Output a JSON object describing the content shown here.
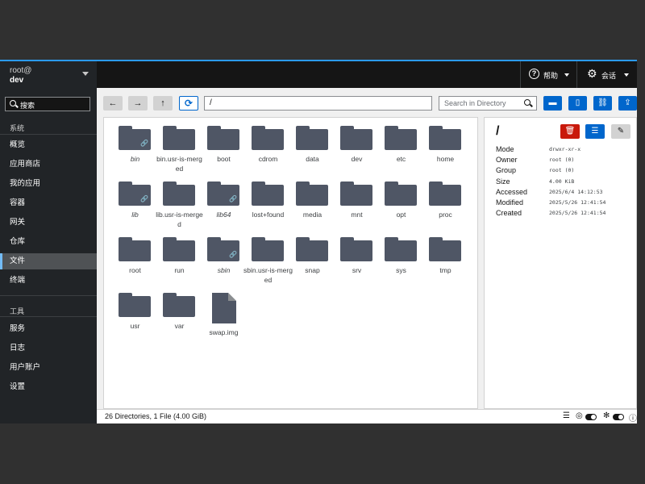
{
  "sidebar": {
    "host_user": "root@",
    "host_name": "dev",
    "search_placeholder": "搜索",
    "section_system": "系统",
    "system_items": [
      "概览",
      "应用商店",
      "我的应用",
      "容器",
      "网关",
      "仓库",
      "文件",
      "终端"
    ],
    "active_item": "文件",
    "section_tools": "工具",
    "tools_items": [
      "服务",
      "日志",
      "用户账户",
      "设置"
    ]
  },
  "topbar": {
    "help_label": "帮助",
    "session_label": "会话"
  },
  "toolbar": {
    "path": "/",
    "search_placeholder": "Search in Directory"
  },
  "files": [
    {
      "name": "bin",
      "type": "folder",
      "link": true
    },
    {
      "name": "bin.usr-is-merged",
      "type": "folder",
      "link": false
    },
    {
      "name": "boot",
      "type": "folder",
      "link": false
    },
    {
      "name": "cdrom",
      "type": "folder",
      "link": false
    },
    {
      "name": "data",
      "type": "folder",
      "link": false
    },
    {
      "name": "dev",
      "type": "folder",
      "link": false
    },
    {
      "name": "etc",
      "type": "folder",
      "link": false
    },
    {
      "name": "home",
      "type": "folder",
      "link": false
    },
    {
      "name": "lib",
      "type": "folder",
      "link": true
    },
    {
      "name": "lib.usr-is-merged",
      "type": "folder",
      "link": false
    },
    {
      "name": "lib64",
      "type": "folder",
      "link": true
    },
    {
      "name": "lost+found",
      "type": "folder",
      "link": false
    },
    {
      "name": "media",
      "type": "folder",
      "link": false
    },
    {
      "name": "mnt",
      "type": "folder",
      "link": false
    },
    {
      "name": "opt",
      "type": "folder",
      "link": false
    },
    {
      "name": "proc",
      "type": "folder",
      "link": false
    },
    {
      "name": "root",
      "type": "folder",
      "link": false
    },
    {
      "name": "run",
      "type": "folder",
      "link": false
    },
    {
      "name": "sbin",
      "type": "folder",
      "link": true
    },
    {
      "name": "sbin.usr-is-merged",
      "type": "folder",
      "link": false
    },
    {
      "name": "snap",
      "type": "folder",
      "link": false
    },
    {
      "name": "srv",
      "type": "folder",
      "link": false
    },
    {
      "name": "sys",
      "type": "folder",
      "link": false
    },
    {
      "name": "tmp",
      "type": "folder",
      "link": false
    },
    {
      "name": "usr",
      "type": "folder",
      "link": false
    },
    {
      "name": "var",
      "type": "folder",
      "link": false
    },
    {
      "name": "swap.img",
      "type": "file",
      "link": false
    }
  ],
  "details": {
    "title": "/",
    "props": [
      {
        "label": "Mode",
        "value": "drwxr-xr-x"
      },
      {
        "label": "Owner",
        "value": "root (0)"
      },
      {
        "label": "Group",
        "value": "root (0)"
      },
      {
        "label": "Size",
        "value": "4.00 KiB"
      },
      {
        "label": "Accessed",
        "value": "2025/6/4 14:12:53"
      },
      {
        "label": "Modified",
        "value": "2025/5/26 12:41:54"
      },
      {
        "label": "Created",
        "value": "2025/5/26 12:41:54"
      }
    ]
  },
  "status": {
    "summary": "26 Directories, 1 File (4.00 GiB)"
  },
  "colors": {
    "accent": "#0066cc",
    "danger": "#c9190b",
    "folder": "#4f5665",
    "sidebar_bg": "#212427",
    "topbar_bg": "#151515"
  }
}
